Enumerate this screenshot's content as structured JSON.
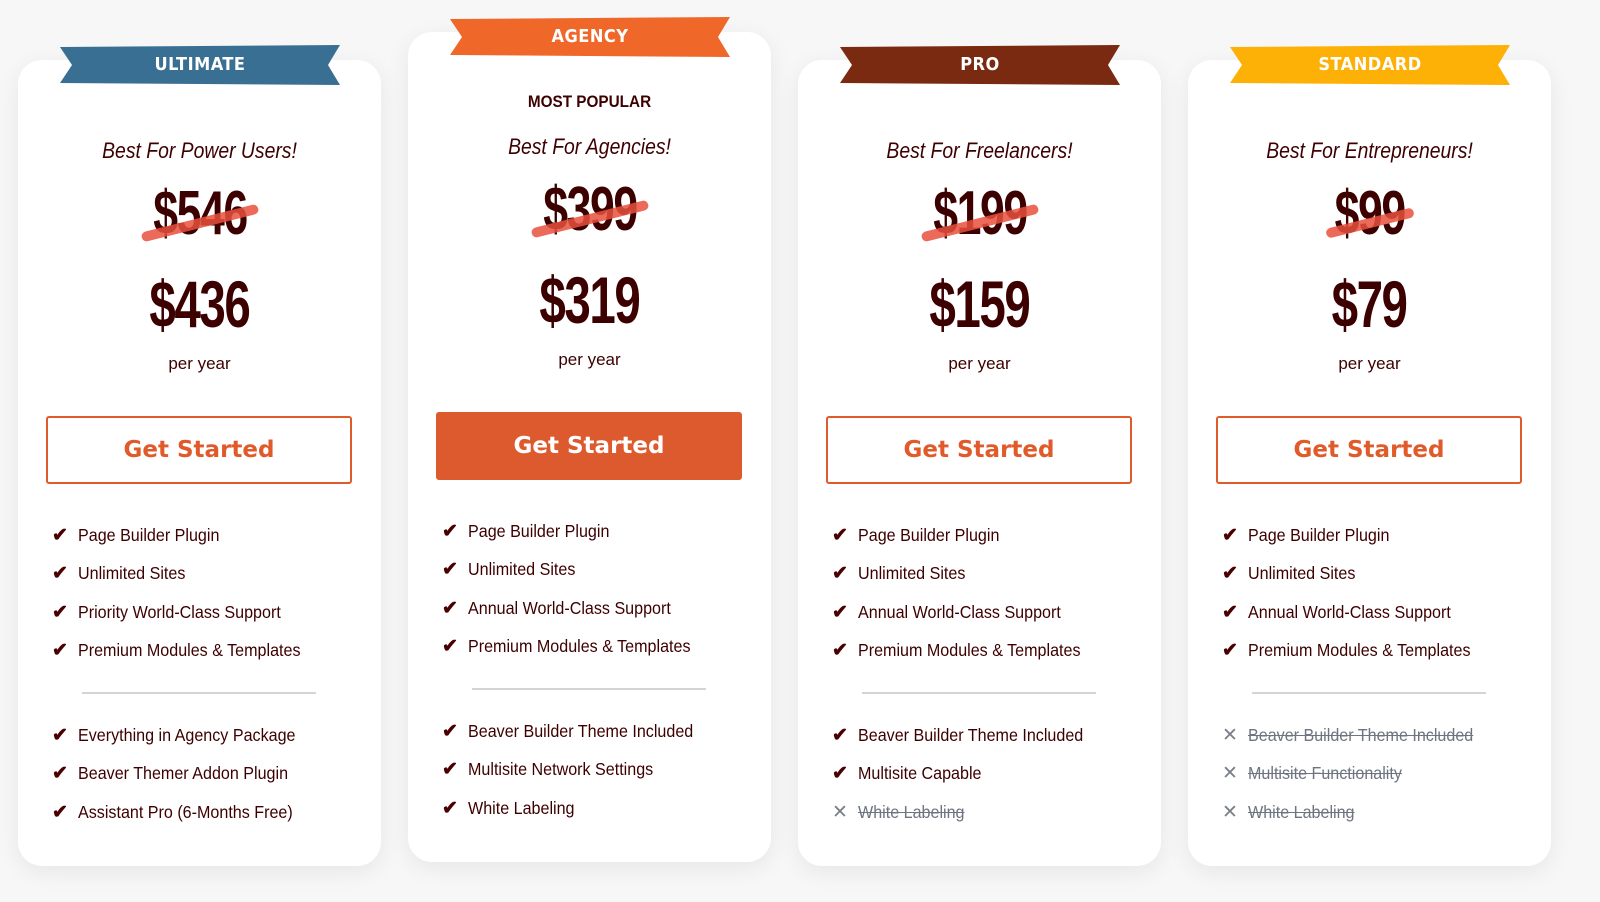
{
  "colors": {
    "ultimate": "#3a6f94",
    "agency": "#f0672a",
    "pro": "#7a2a10",
    "standard": "#fdb006",
    "accent": "#dc5a2e",
    "text": "#3d0000",
    "strike": "#e8503c"
  },
  "plans": [
    {
      "ribbon": "ULTIMATE",
      "badge": "",
      "tagline": "Best For Power Users!",
      "old_price": "$546",
      "price": "$436",
      "period": "per year",
      "button": "Get Started",
      "features": [
        {
          "label": "Page Builder Plugin",
          "included": true
        },
        {
          "label": "Unlimited Sites",
          "included": true
        },
        {
          "label": "Priority World-Class Support",
          "included": true
        },
        {
          "label": "Premium Modules & Templates",
          "included": true
        }
      ],
      "extras": [
        {
          "label": "Everything in Agency Package",
          "included": true
        },
        {
          "label": "Beaver Themer Addon Plugin",
          "included": true
        },
        {
          "label": "Assistant Pro (6-Months Free)",
          "included": true
        }
      ]
    },
    {
      "ribbon": "AGENCY",
      "badge": "MOST POPULAR",
      "tagline": "Best For Agencies!",
      "old_price": "$399",
      "price": "$319",
      "period": "per year",
      "button": "Get Started",
      "features": [
        {
          "label": "Page Builder Plugin",
          "included": true
        },
        {
          "label": "Unlimited Sites",
          "included": true
        },
        {
          "label": "Annual World-Class Support",
          "included": true
        },
        {
          "label": "Premium Modules & Templates",
          "included": true
        }
      ],
      "extras": [
        {
          "label": "Beaver Builder Theme Included",
          "included": true
        },
        {
          "label": "Multisite Network Settings",
          "included": true
        },
        {
          "label": "White Labeling",
          "included": true
        }
      ]
    },
    {
      "ribbon": "PRO",
      "badge": "",
      "tagline": "Best For Freelancers!",
      "old_price": "$199",
      "price": "$159",
      "period": "per year",
      "button": "Get Started",
      "features": [
        {
          "label": "Page Builder Plugin",
          "included": true
        },
        {
          "label": "Unlimited Sites",
          "included": true
        },
        {
          "label": "Annual World-Class Support",
          "included": true
        },
        {
          "label": "Premium Modules & Templates",
          "included": true
        }
      ],
      "extras": [
        {
          "label": "Beaver Builder Theme Included",
          "included": true
        },
        {
          "label": "Multisite Capable",
          "included": true
        },
        {
          "label": "White Labeling",
          "included": false
        }
      ]
    },
    {
      "ribbon": "STANDARD",
      "badge": "",
      "tagline": "Best For Entrepreneurs!",
      "old_price": "$99",
      "price": "$79",
      "period": "per year",
      "button": "Get Started",
      "features": [
        {
          "label": "Page Builder Plugin",
          "included": true
        },
        {
          "label": "Unlimited Sites",
          "included": true
        },
        {
          "label": "Annual World-Class Support",
          "included": true
        },
        {
          "label": "Premium Modules & Templates",
          "included": true
        }
      ],
      "extras": [
        {
          "label": "Beaver Builder Theme Included",
          "included": false
        },
        {
          "label": "Multisite Functionality",
          "included": false
        },
        {
          "label": "White Labeling",
          "included": false
        }
      ]
    }
  ],
  "icons": {
    "check": "✔",
    "cross": "✕"
  }
}
